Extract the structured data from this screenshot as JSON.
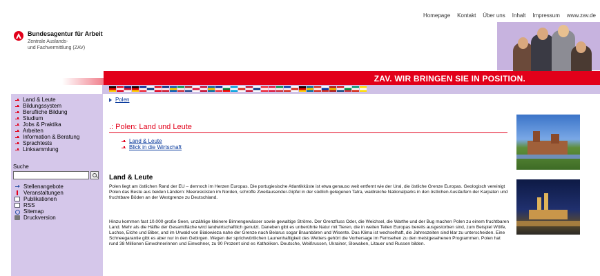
{
  "top_nav": [
    "Homepage",
    "Kontakt",
    "Über uns",
    "Inhalt",
    "Impressum",
    "www.zav.de"
  ],
  "logo": {
    "title": "Bundesagentur für Arbeit",
    "subtitle_line1": "Zentrale Auslands-",
    "subtitle_line2": "und Fachvermittlung (ZAV)"
  },
  "banner": {
    "slogan": "ZAV. WIR BRINGEN SIE IN POSITION."
  },
  "flag_bar": {
    "flags": [
      [
        "#000000",
        "#dd0000",
        "#ffce00"
      ],
      [
        "#e2001a",
        "#ffffff",
        "#e2001a"
      ],
      [
        "#00247d",
        "#cf142b",
        "#ffffff"
      ],
      [
        "#000000",
        "#dd0000",
        "#ffce00"
      ],
      [
        "#002395",
        "#ffffff",
        "#ed2939"
      ],
      [
        "#ffffff",
        "#003580",
        "#ffffff"
      ],
      [
        "#e2001a",
        "#ffffff",
        "#e2001a"
      ],
      [
        "#00247d",
        "#ffffff",
        "#cf142b"
      ],
      [
        "#0057b8",
        "#ffd700",
        "#0057b8"
      ],
      [
        "#009246",
        "#ffffff",
        "#ce2b37"
      ],
      [
        "#ae1c28",
        "#ffffff",
        "#21468b"
      ],
      [
        "#ffffff",
        "#dc143c",
        "#ffffff"
      ],
      [
        "#c60c30",
        "#ffffff",
        "#c60c30"
      ],
      [
        "#006aa7",
        "#fecc00",
        "#006aa7"
      ],
      [
        "#002395",
        "#ffffff",
        "#ed2939"
      ],
      [
        "#ffffff",
        "#00843d",
        "#ff0000"
      ],
      [
        "#00a3dd",
        "#ffffff",
        "#00a3dd"
      ],
      [
        "#ffffff",
        "#d52b1e",
        "#ffffff"
      ],
      [
        "#c8102e",
        "#ffffff",
        "#c8102e"
      ],
      [
        "#ffffff",
        "#003580",
        "#ffffff"
      ],
      [
        "#ed2939",
        "#ffffff",
        "#ed2939"
      ],
      [
        "#dc143c",
        "#ffffff",
        "#dc143c"
      ],
      [
        "#009246",
        "#ffffff",
        "#ce2b37"
      ],
      [
        "#0039a6",
        "#ffffff",
        "#d52b1e"
      ],
      [
        "#ffffff",
        "#d52b1e",
        "#ffffff"
      ],
      [
        "#000000",
        "#dd0000",
        "#ffce00"
      ],
      [
        "#006aa7",
        "#fecc00",
        "#006aa7"
      ],
      [
        "#d52b1e",
        "#ffffff",
        "#d52b1e"
      ],
      [
        "#ffffff",
        "#0039a6",
        "#d52b1e"
      ],
      [
        "#aa151b",
        "#f1bf00",
        "#aa151b"
      ],
      [
        "#d7141a",
        "#ffffff",
        "#11457e"
      ],
      [
        "#ffffff",
        "#009246",
        "#ce2b37"
      ],
      [
        "#00966e",
        "#ffffff",
        "#d62612"
      ],
      [
        "#ffde00",
        "#ffffff",
        "#ffde00"
      ]
    ]
  },
  "sidebar": {
    "menu": [
      "Land & Leute",
      "Bildungssystem",
      "Berufliche Bildung",
      "Studium",
      "Jobs & Praktika",
      "Arbeiten",
      "Information & Beratung",
      "Sprachtests",
      "Linksammlung"
    ],
    "search_label": "Suche",
    "search_value": "",
    "tools": [
      {
        "label": "Stellenangebote",
        "icon": "arrow"
      },
      {
        "label": "Veranstaltungen",
        "icon": "pin"
      },
      {
        "label": "Publikationen",
        "icon": "doc"
      },
      {
        "label": "RSS",
        "icon": "rss"
      },
      {
        "label": "Sitemap",
        "icon": "map"
      },
      {
        "label": "Druckversion",
        "icon": "print"
      }
    ]
  },
  "breadcrumb": {
    "link": "Polen"
  },
  "main": {
    "title": "Polen: Land und Leute",
    "sublinks": [
      "Land & Leute",
      "Blick in die Wirtschaft"
    ],
    "section_heading": "Land & Leute",
    "paragraph1": "Polen liegt am östlichen Rand der EU – dennoch im Herzen Europas. Die portugiesische Atlantikküste ist etwa genauso weit entfernt wie der Ural, die östliche Grenze Europas. Geologisch vereinigt Polen das Beste aus beiden Ländern: Meeresküsten im Norden, schroffe Zweitausender-Gipfel in der südlich gelegenen Tatra, waldreiche Nationalparks in den östlichen Ausläufern der Karpaten und fruchtbare Böden an der Westgrenze zu Deutschland.",
    "paragraph2": "Hinzu kommen fast 10.000 große Seen, unzählige kleinere Binnengewässer sowie gewaltige Ströme. Der Grenzfluss Oder, die Weichsel, die Warthe und der Bug machen Polen zu einem fruchtbaren Land. Mehr als die Hälfte der Gesamtfläche wird landwirtschaftlich genutzt. Daneben gibt es unberührte Natur mit Tieren, die in weiten Teilen Europas bereits ausgestorben sind, zum Beispiel Wölfe, Luchse, Elche und Biber, und im Urwald von Bialowieza nahe der Grenze nach Belarus sogar Braunbären und Wisente. Das Klima ist wechselhaft, die Jahreszeiten sind klar zu unterscheiden. Eine Schneegarantie gibt es aber nur in den Gebirgen. Wegen der sprichwörtlichen Launenhaftigkeit des Wetters gehört die Vorhersage im Fernsehen zu den meistgesehenen Programmen. Polen hat rund 38 Millionen Einwohnerinnen und Einwohner, zu 90 Prozent sind es Katholiken. Deutsche, Weißrussen, Ukrainer, Slowaken, Litauer und Russen bilden."
  },
  "colors": {
    "brand_red": "#e2001a",
    "sidebar_lilac": "#d5c7ea",
    "link_blue": "#003399"
  }
}
